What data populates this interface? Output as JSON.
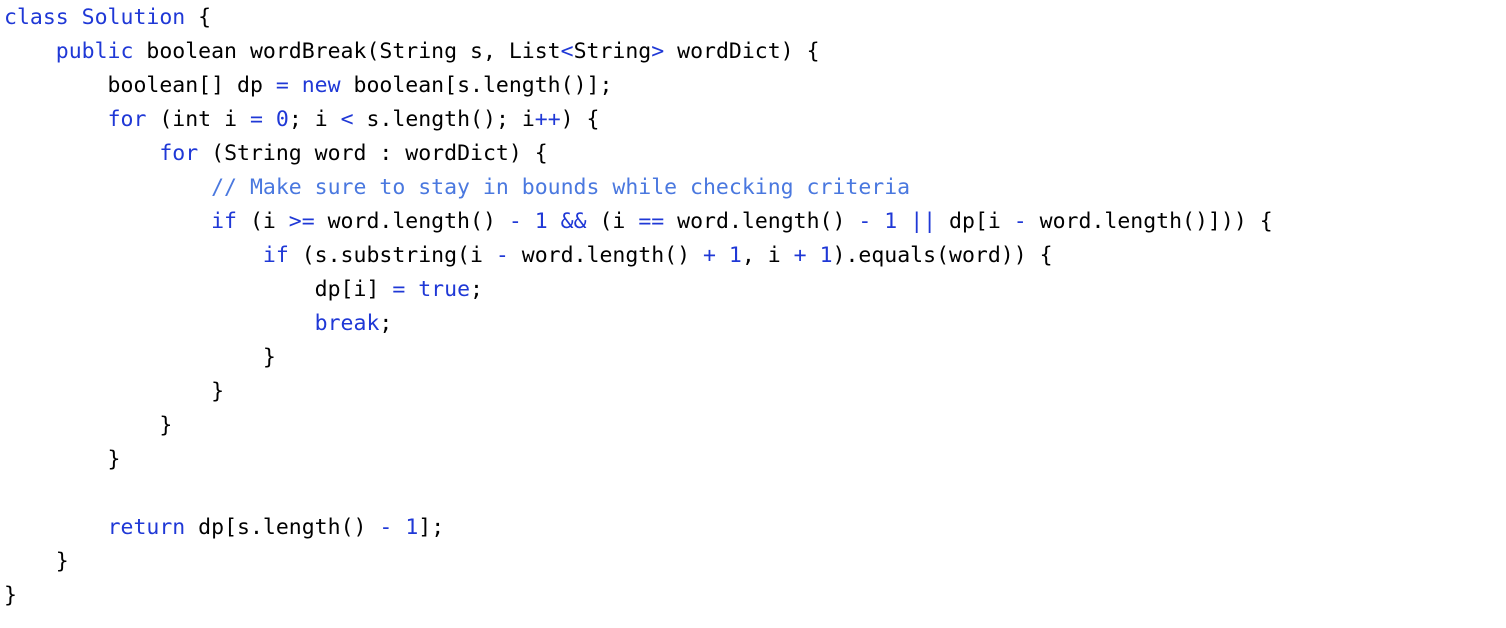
{
  "colors": {
    "keyword": "#1f38d6",
    "operator": "#1f38d6",
    "number": "#1f38d6",
    "comment": "#4a78df",
    "plain": "#000000",
    "background": "#ffffff"
  },
  "code": {
    "lines": [
      {
        "tokens": [
          {
            "t": "class Solution",
            "k": "kw-mixed-class"
          },
          {
            "t": " {",
            "k": "plain"
          }
        ]
      },
      {
        "tokens": [
          {
            "t": "    ",
            "k": "plain"
          },
          {
            "t": "public",
            "k": "kw"
          },
          {
            "t": " boolean wordBreak(String s, List",
            "k": "plain"
          },
          {
            "t": "<",
            "k": "op"
          },
          {
            "t": "String",
            "k": "plain"
          },
          {
            "t": ">",
            "k": "op"
          },
          {
            "t": " wordDict) {",
            "k": "plain"
          }
        ]
      },
      {
        "tokens": [
          {
            "t": "        boolean[] dp ",
            "k": "plain"
          },
          {
            "t": "=",
            "k": "op"
          },
          {
            "t": " ",
            "k": "plain"
          },
          {
            "t": "new",
            "k": "kw"
          },
          {
            "t": " boolean[s.length()];",
            "k": "plain"
          }
        ]
      },
      {
        "tokens": [
          {
            "t": "        ",
            "k": "plain"
          },
          {
            "t": "for",
            "k": "kw"
          },
          {
            "t": " (int i ",
            "k": "plain"
          },
          {
            "t": "=",
            "k": "op"
          },
          {
            "t": " ",
            "k": "plain"
          },
          {
            "t": "0",
            "k": "num"
          },
          {
            "t": "; i ",
            "k": "plain"
          },
          {
            "t": "<",
            "k": "op"
          },
          {
            "t": " s.length(); i",
            "k": "plain"
          },
          {
            "t": "++",
            "k": "op"
          },
          {
            "t": ") {",
            "k": "plain"
          }
        ]
      },
      {
        "tokens": [
          {
            "t": "            ",
            "k": "plain"
          },
          {
            "t": "for",
            "k": "kw"
          },
          {
            "t": " (String word : wordDict) {",
            "k": "plain"
          }
        ]
      },
      {
        "tokens": [
          {
            "t": "                ",
            "k": "plain"
          },
          {
            "t": "// Make sure to stay in bounds while checking criteria",
            "k": "cm"
          }
        ]
      },
      {
        "tokens": [
          {
            "t": "                ",
            "k": "plain"
          },
          {
            "t": "if",
            "k": "kw"
          },
          {
            "t": " (i ",
            "k": "plain"
          },
          {
            "t": ">=",
            "k": "op"
          },
          {
            "t": " word.length() ",
            "k": "plain"
          },
          {
            "t": "-",
            "k": "op"
          },
          {
            "t": " ",
            "k": "plain"
          },
          {
            "t": "1",
            "k": "num"
          },
          {
            "t": " ",
            "k": "plain"
          },
          {
            "t": "&&",
            "k": "op"
          },
          {
            "t": " (i ",
            "k": "plain"
          },
          {
            "t": "==",
            "k": "op"
          },
          {
            "t": " word.length() ",
            "k": "plain"
          },
          {
            "t": "-",
            "k": "op"
          },
          {
            "t": " ",
            "k": "plain"
          },
          {
            "t": "1",
            "k": "num"
          },
          {
            "t": " ",
            "k": "plain"
          },
          {
            "t": "||",
            "k": "op"
          },
          {
            "t": " dp[i ",
            "k": "plain"
          },
          {
            "t": "-",
            "k": "op"
          },
          {
            "t": " word.length()])) {",
            "k": "plain"
          }
        ]
      },
      {
        "tokens": [
          {
            "t": "                    ",
            "k": "plain"
          },
          {
            "t": "if",
            "k": "kw"
          },
          {
            "t": " (s.substring(i ",
            "k": "plain"
          },
          {
            "t": "-",
            "k": "op"
          },
          {
            "t": " word.length() ",
            "k": "plain"
          },
          {
            "t": "+",
            "k": "op"
          },
          {
            "t": " ",
            "k": "plain"
          },
          {
            "t": "1",
            "k": "num"
          },
          {
            "t": ", i ",
            "k": "plain"
          },
          {
            "t": "+",
            "k": "op"
          },
          {
            "t": " ",
            "k": "plain"
          },
          {
            "t": "1",
            "k": "num"
          },
          {
            "t": ").equals(word)) {",
            "k": "plain"
          }
        ]
      },
      {
        "tokens": [
          {
            "t": "                        dp[i] ",
            "k": "plain"
          },
          {
            "t": "=",
            "k": "op"
          },
          {
            "t": " ",
            "k": "plain"
          },
          {
            "t": "true",
            "k": "kw"
          },
          {
            "t": ";",
            "k": "plain"
          }
        ]
      },
      {
        "tokens": [
          {
            "t": "                        ",
            "k": "plain"
          },
          {
            "t": "break",
            "k": "kw"
          },
          {
            "t": ";",
            "k": "plain"
          }
        ]
      },
      {
        "tokens": [
          {
            "t": "                    }",
            "k": "plain"
          }
        ]
      },
      {
        "tokens": [
          {
            "t": "                }",
            "k": "plain"
          }
        ]
      },
      {
        "tokens": [
          {
            "t": "            }",
            "k": "plain"
          }
        ]
      },
      {
        "tokens": [
          {
            "t": "        }",
            "k": "plain"
          }
        ]
      },
      {
        "tokens": [
          {
            "t": "",
            "k": "plain"
          }
        ]
      },
      {
        "tokens": [
          {
            "t": "        ",
            "k": "plain"
          },
          {
            "t": "return",
            "k": "kw"
          },
          {
            "t": " dp[s.length() ",
            "k": "plain"
          },
          {
            "t": "-",
            "k": "op"
          },
          {
            "t": " ",
            "k": "plain"
          },
          {
            "t": "1",
            "k": "num"
          },
          {
            "t": "];",
            "k": "plain"
          }
        ]
      },
      {
        "tokens": [
          {
            "t": "    }",
            "k": "plain"
          }
        ]
      },
      {
        "tokens": [
          {
            "t": "}",
            "k": "plain"
          }
        ]
      }
    ]
  }
}
